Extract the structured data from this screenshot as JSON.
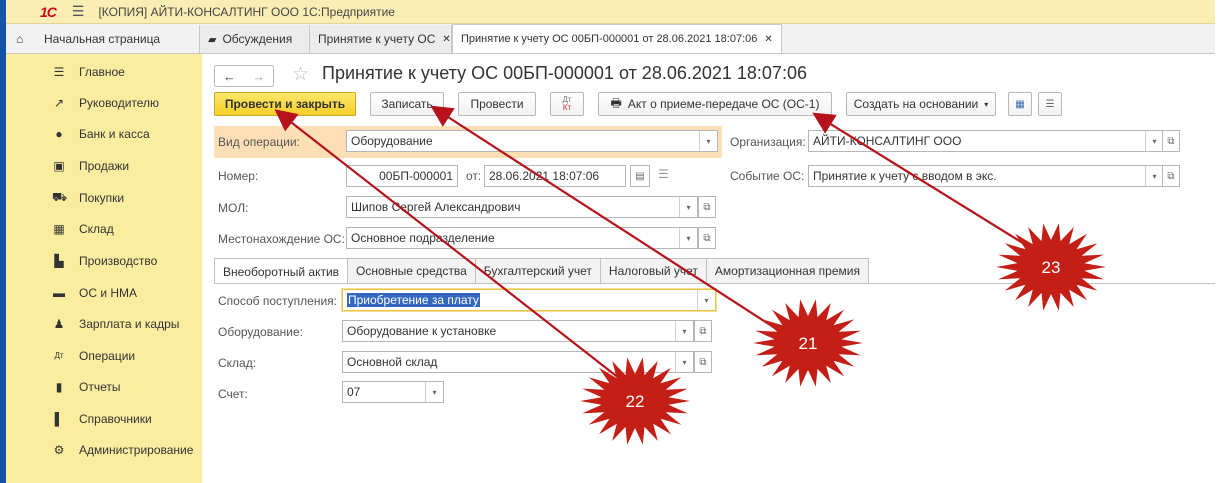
{
  "app": {
    "logo": "1С",
    "title": "[КОПИЯ] АЙТИ-КОНСАЛТИНГ ООО 1С:Предприятие"
  },
  "window_tabs": [
    {
      "label": "Начальная страница",
      "icon": "home-icon"
    },
    {
      "label": "Обсуждения",
      "icon": "chat-icon"
    },
    {
      "label": "Принятие к учету ОС",
      "closable": true
    },
    {
      "label": "Принятие к учету ОС 00БП-000001 от 28.06.2021 18:07:06",
      "closable": true,
      "active": true
    }
  ],
  "sidebar": {
    "items": [
      {
        "label": "Главное",
        "icon": "menu-lines-icon"
      },
      {
        "label": "Руководителю",
        "icon": "trend-icon"
      },
      {
        "label": "Банк и касса",
        "icon": "ruble-coin-icon"
      },
      {
        "label": "Продажи",
        "icon": "shopping-bag-icon"
      },
      {
        "label": "Покупки",
        "icon": "cart-icon"
      },
      {
        "label": "Склад",
        "icon": "warehouse-icon"
      },
      {
        "label": "Производство",
        "icon": "factory-icon"
      },
      {
        "label": "ОС и НМА",
        "icon": "truck-icon"
      },
      {
        "label": "Зарплата и кадры",
        "icon": "person-icon"
      },
      {
        "label": "Операции",
        "icon": "debit-credit-icon"
      },
      {
        "label": "Отчеты",
        "icon": "bar-chart-icon"
      },
      {
        "label": "Справочники",
        "icon": "book-icon"
      },
      {
        "label": "Администрирование",
        "icon": "gear-icon"
      }
    ]
  },
  "document": {
    "title": "Принятие к учету ОС 00БП-000001 от 28.06.2021 18:07:06"
  },
  "toolbar": {
    "post_close": "Провести и закрыть",
    "save": "Записать",
    "post": "Провести",
    "dtkt_top": "Дт",
    "dtkt_bottom": "Кт",
    "act": "Акт о приеме-передаче ОС (ОС-1)",
    "create_based": "Создать на основании"
  },
  "form": {
    "operation_label": "Вид операции:",
    "operation_value": "Оборудование",
    "org_label": "Организация:",
    "org_value": "АЙТИ-КОНСАЛТИНГ ООО",
    "number_label": "Номер:",
    "number_value": "00БП-000001",
    "date_label": "от:",
    "date_value": "28.06.2021 18:07:06",
    "event_label": "Событие ОС:",
    "event_value": "Принятие к учету с вводом в экс.",
    "mol_label": "МОЛ:",
    "mol_value": "Шипов Сергей Александрович",
    "location_label": "Местонахождение ОС:",
    "location_value": "Основное подразделение"
  },
  "form_tabs": [
    "Внеоборотный актив",
    "Основные средства",
    "Бухгалтерский учет",
    "Налоговый учет",
    "Амортизационная премия"
  ],
  "asset_tab": {
    "receipt_label": "Способ поступления:",
    "receipt_value": "Приобретение за плату",
    "equipment_label": "Оборудование:",
    "equipment_value": "Оборудование к установке",
    "warehouse_label": "Склад:",
    "warehouse_value": "Основной склад",
    "account_label": "Счет:",
    "account_value": "07"
  },
  "annotations": [
    {
      "number": "21"
    },
    {
      "number": "22"
    },
    {
      "number": "23"
    }
  ],
  "colors": {
    "sidebar_bg": "#fbeda0",
    "primary_button": "#f7cf27",
    "burst": "#c41f17",
    "arrow": "#b5121b"
  }
}
